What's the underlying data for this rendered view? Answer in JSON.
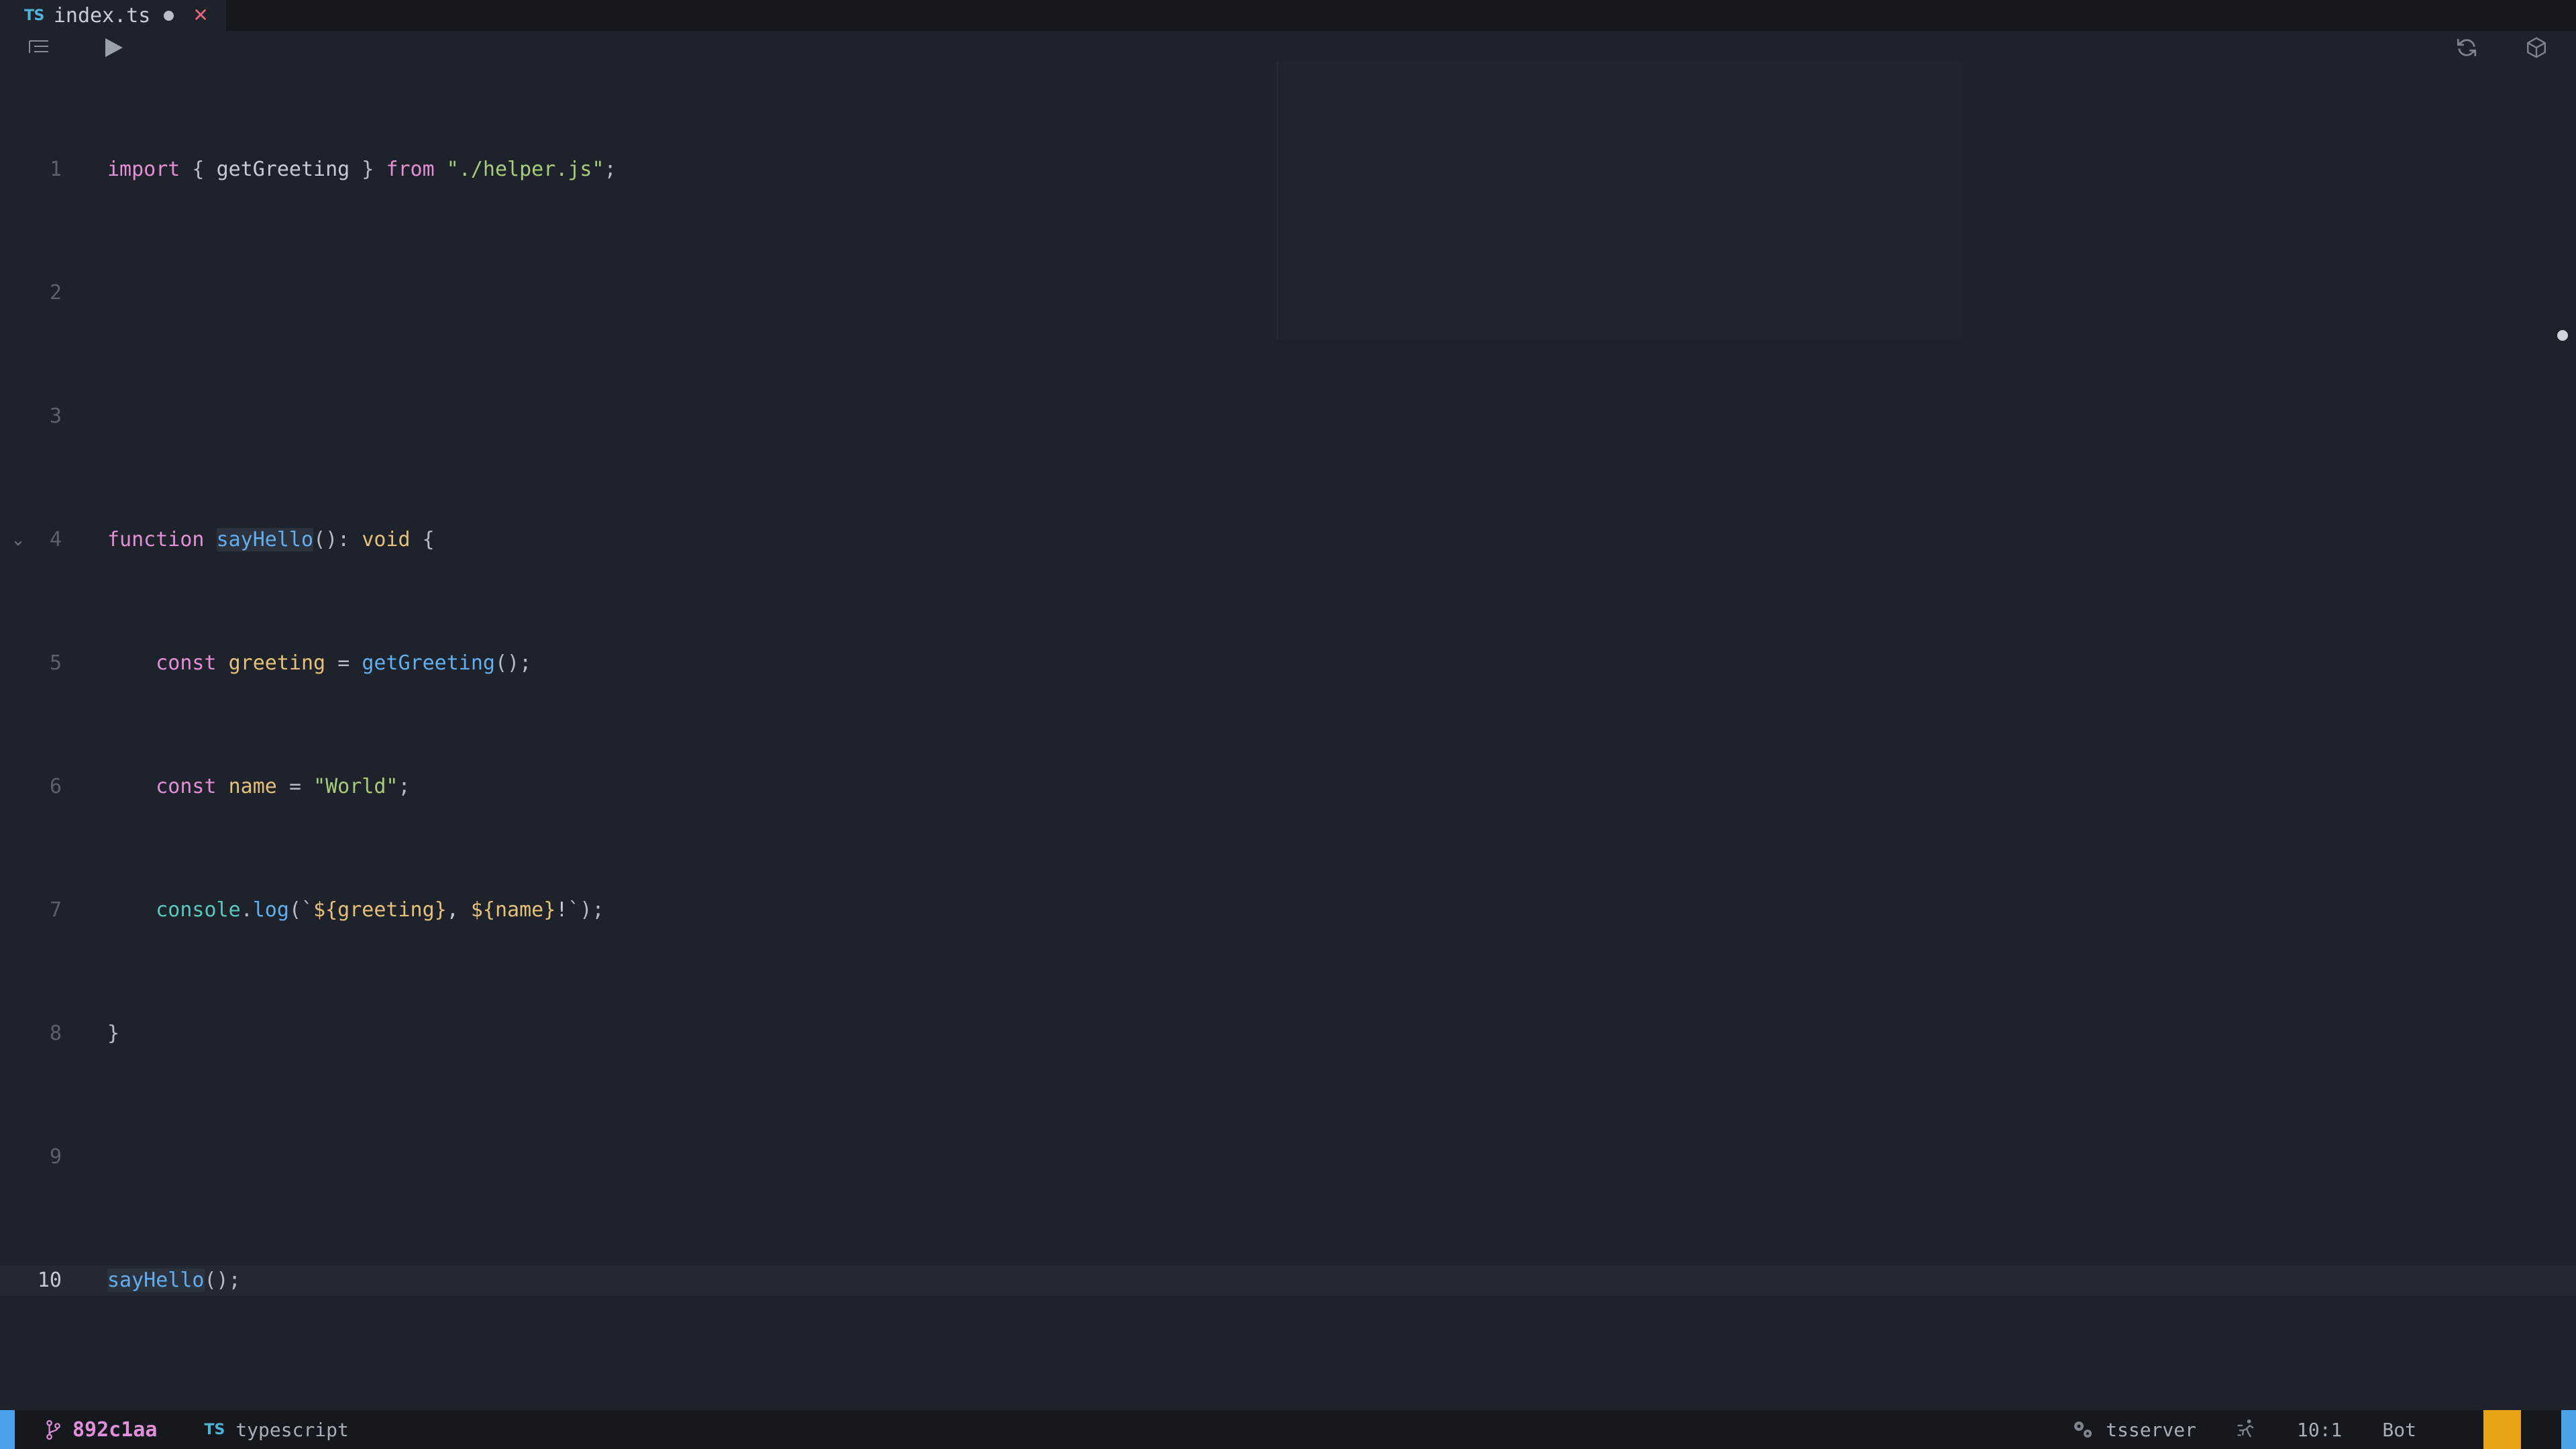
{
  "tab": {
    "lang_badge": "TS",
    "filename": "index.ts",
    "modified_indicator": "●",
    "close_label": "✕"
  },
  "toolbar": {
    "outline_icon": "outline-icon",
    "run_icon": "run-play-icon",
    "refresh_icon": "refresh-icon",
    "package_icon": "package-cube-icon"
  },
  "editor": {
    "lines": [
      {
        "num": "1",
        "fold": ""
      },
      {
        "num": "2",
        "fold": ""
      },
      {
        "num": "3",
        "fold": ""
      },
      {
        "num": "4",
        "fold": "⌄"
      },
      {
        "num": "5",
        "fold": ""
      },
      {
        "num": "6",
        "fold": ""
      },
      {
        "num": "7",
        "fold": ""
      },
      {
        "num": "8",
        "fold": ""
      },
      {
        "num": "9",
        "fold": ""
      },
      {
        "num": "10",
        "fold": ""
      }
    ],
    "code": {
      "l1_import": "import",
      "l1_brace_open": " { ",
      "l1_named": "getGreeting",
      "l1_brace_close": " } ",
      "l1_from": "from",
      "l1_space": " ",
      "l1_module": "\"./helper.js\"",
      "l1_semi": ";",
      "l4_function": "function",
      "l4_name": "sayHello",
      "l4_sig": "(): ",
      "l4_void": "void",
      "l4_open": " {",
      "l5_indent": "    ",
      "l5_const": "const",
      "l5_var": " greeting ",
      "l5_eq": "= ",
      "l5_call": "getGreeting",
      "l5_tail": "();",
      "l6_indent": "    ",
      "l6_const": "const",
      "l6_var": " name ",
      "l6_eq": "= ",
      "l6_str": "\"World\"",
      "l6_semi": ";",
      "l7_indent": "    ",
      "l7_console": "console",
      "l7_dot": ".",
      "l7_log": "log",
      "l7_open": "(`",
      "l7_tpl1": "${greeting}",
      "l7_mid": ", ",
      "l7_tpl2": "${name}",
      "l7_bang": "!",
      "l7_close": "`);",
      "l8_close": "}",
      "l10_call": "sayHello",
      "l10_tail": "();"
    }
  },
  "statusbar": {
    "branch_icon": "git-branch-icon",
    "branch": "892c1aa",
    "lang_badge": "TS",
    "language": "typescript",
    "gears_icon": "gears-icon",
    "server": "tsserver",
    "run_icon": "run-debug-icon",
    "cursor_position": "10:1",
    "encoding_or_mode": "Bot"
  },
  "colors": {
    "editor_bg": "#1e222a",
    "tabbar_bg": "#181b21",
    "statusbar_bg": "#15181d",
    "accent_blue": "#4aa3e8",
    "accent_orange": "#e8a317",
    "branch_pink": "#e08fd8",
    "keyword_pink": "#e58fd6",
    "string_green": "#a8cc7c",
    "function_blue": "#62aeef",
    "type_yellow": "#e5c07b",
    "object_teal": "#5bc8be",
    "close_red": "#e4697d"
  }
}
